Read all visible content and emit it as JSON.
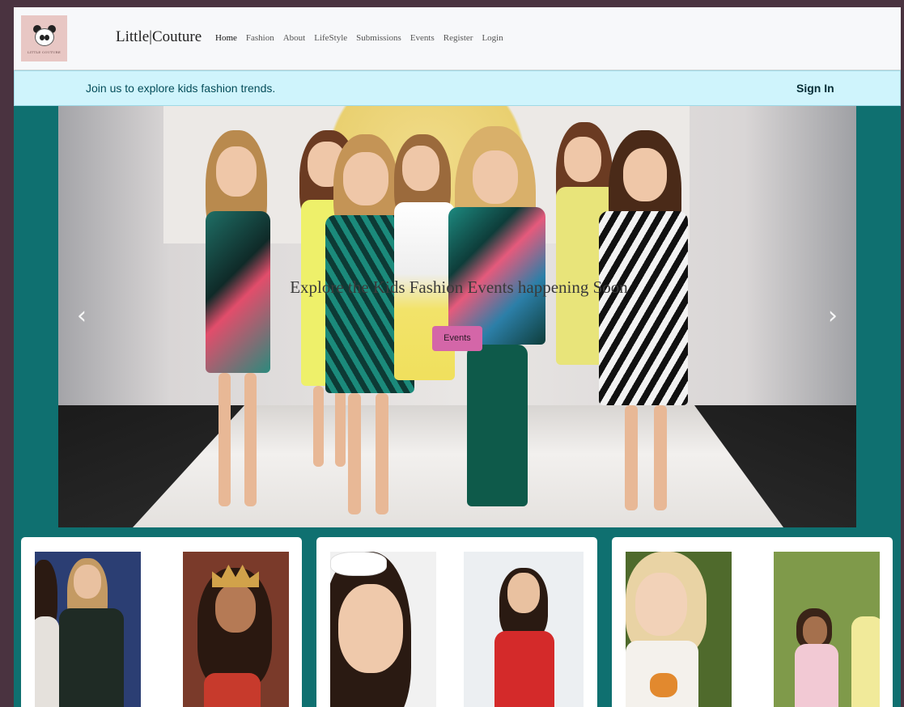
{
  "nav": {
    "logo_caption": "LITTLE COUTURE",
    "brand": "Little|Couture",
    "links": [
      "Home",
      "Fashion",
      "About",
      "LifeStyle",
      "Submissions",
      "Events",
      "Register",
      "Login"
    ]
  },
  "banner": {
    "message": "Join us to explore kids fashion trends.",
    "signin": "Sign In"
  },
  "carousel": {
    "caption": "Explore the Kids Fashion Events happening Soon",
    "button": "Events",
    "prev_icon": "‹",
    "next_icon": "›"
  },
  "colors": {
    "page_bg": "#0f7070",
    "banner_bg": "#cff4fc",
    "events_button": "#d466a8",
    "navbar_bg": "#f7f8fa"
  },
  "icons": [
    "panda-logo",
    "chevron-left-icon",
    "chevron-right-icon"
  ]
}
